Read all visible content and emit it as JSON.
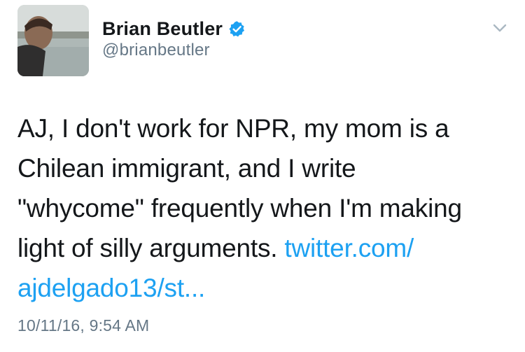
{
  "author": {
    "display_name": "Brian Beutler",
    "handle": "@brianbeutler",
    "verified": true,
    "avatar_icon": "profile-photo"
  },
  "tweet": {
    "text_lines": [
      "AJ, I don't work for NPR, my mom is a",
      "Chilean immigrant, and I write",
      "\"whycome\" frequently when I'm making"
    ],
    "line4_text": "light of silly arguments. ",
    "link_part1": "twitter.com/",
    "link_part2": "ajdelgado13/st..."
  },
  "timestamp": "10/11/16, 9:54 AM",
  "menu": {
    "icon": "chevron-down-icon"
  },
  "colors": {
    "text": "#14171a",
    "secondary": "#657786",
    "link": "#1da1f2",
    "verified": "#1da1f2"
  }
}
